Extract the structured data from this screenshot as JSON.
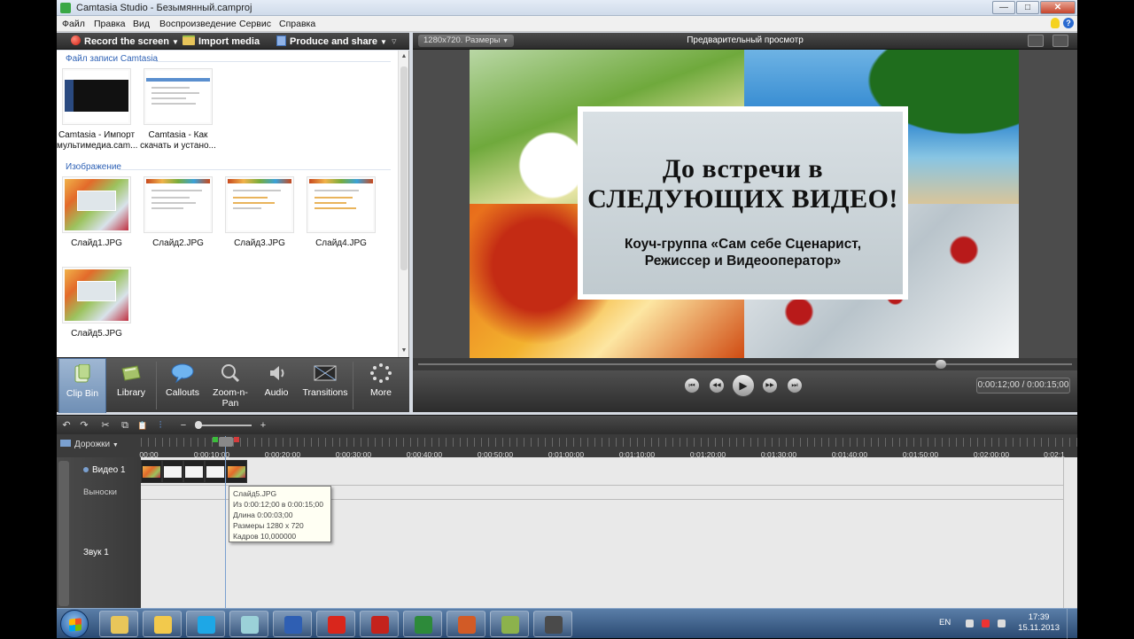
{
  "window": {
    "title": "Camtasia Studio - Безымянный.camproj",
    "minimize_glyph": "—",
    "maximize_glyph": "□",
    "close_glyph": "✕"
  },
  "menu": {
    "items": [
      "Файл",
      "Правка",
      "Вид",
      "Воспроизведение",
      "Сервис",
      "Справка"
    ],
    "help_glyph": "?"
  },
  "toolbar": {
    "record_label": "Record the screen",
    "import_label": "Import media",
    "produce_label": "Produce and share",
    "dropdown_glyph": "▼",
    "collapse_glyph": "▿"
  },
  "clip_bin": {
    "recordings_section": "Файл записи Camtasia",
    "images_section": "Изображение",
    "recordings": [
      {
        "line1": "Camtasia - Импорт",
        "line2": "мультимедиа.cam..."
      },
      {
        "line1": "Camtasia - Как",
        "line2": "скачать и устано..."
      }
    ],
    "images": [
      "Слайд1.JPG",
      "Слайд2.JPG",
      "Слайд3.JPG",
      "Слайд4.JPG",
      "Слайд5.JPG"
    ],
    "scroll_up_glyph": "▲",
    "scroll_down_glyph": "▼"
  },
  "tools": {
    "tabs": [
      {
        "label": "Clip Bin",
        "icon": "clip-bin-icon",
        "active": true
      },
      {
        "label": "Library",
        "icon": "library-icon",
        "active": false
      },
      {
        "label": "Callouts",
        "icon": "callouts-icon",
        "active": false
      },
      {
        "label": "Zoom-n-Pan",
        "icon": "zoom-icon",
        "active": false
      },
      {
        "label": "Audio",
        "icon": "audio-icon",
        "active": false
      },
      {
        "label": "Transitions",
        "icon": "transitions-icon",
        "active": false
      },
      {
        "label": "More",
        "icon": "more-icon",
        "active": false
      }
    ],
    "zoom_label_line1": "Zoom-n-",
    "zoom_label_line2": "Pan"
  },
  "preview": {
    "size_dropdown": "1280x720. Размеры",
    "title": "Предварительный просмотр",
    "slide_title_line1": "До встречи в",
    "slide_title_line2": "следующих видео!",
    "slide_subtitle_line1": "Коуч-группа «Сам себе Сценарист,",
    "slide_subtitle_line2": "Режиссер и Видеооператор»",
    "time": "0:00:12;00 / 0:00:15;00",
    "seek_position": 0.8
  },
  "player": {
    "prev_glyph": "⏮",
    "rewind_glyph": "◀◀",
    "play_glyph": "▶",
    "forward_glyph": "▶▶",
    "next_glyph": "⏭"
  },
  "timeline": {
    "tracks_label": "Дорожки",
    "ruler_ticks": [
      "00;00",
      "0:00:10;00",
      "0:00:20;00",
      "0:00:30;00",
      "0:00:40;00",
      "0:00:50;00",
      "0:01:00;00",
      "0:01:10;00",
      "0:01:20;00",
      "0:01:30;00",
      "0:01:40;00",
      "0:01:50;00",
      "0:02:00;00",
      "0:02:1"
    ],
    "track_video": "Видео 1",
    "track_callouts": "Выноски",
    "track_audio": "Звук 1",
    "tool_glyphs": {
      "undo": "↶",
      "redo": "↷",
      "cut": "✂",
      "copy": "⧉",
      "paste": "📋",
      "split": "⫶",
      "zoom_out": "−",
      "zoom_in": "+"
    }
  },
  "tooltip": {
    "name": "Слайд5.JPG",
    "range": "Из 0:00:12;00 в 0:00:15;00",
    "duration": "Длина 0:00:03;00",
    "dimensions": "Размеры 1280 x 720",
    "frames": "Кадров 10,000000"
  },
  "taskbar": {
    "language": "EN",
    "time": "17:39",
    "date": "15.11.2013",
    "apps": [
      {
        "name": "explorer-app",
        "color": "#e8c65a"
      },
      {
        "name": "chrome-app",
        "color": "#f2c94c"
      },
      {
        "name": "skype-app",
        "color": "#1ea7e6"
      },
      {
        "name": "files-app",
        "color": "#9bd1d8"
      },
      {
        "name": "word-app",
        "color": "#2f5fb3"
      },
      {
        "name": "yandex-app",
        "color": "#d9261c"
      },
      {
        "name": "acrobat-app",
        "color": "#c4231c"
      },
      {
        "name": "excel-app",
        "color": "#2d8a3a"
      },
      {
        "name": "powerpoint-app",
        "color": "#d25b26"
      },
      {
        "name": "camtasia-app",
        "color": "#8cb24c"
      },
      {
        "name": "recorder-app",
        "color": "#4a4a4a"
      }
    ]
  }
}
